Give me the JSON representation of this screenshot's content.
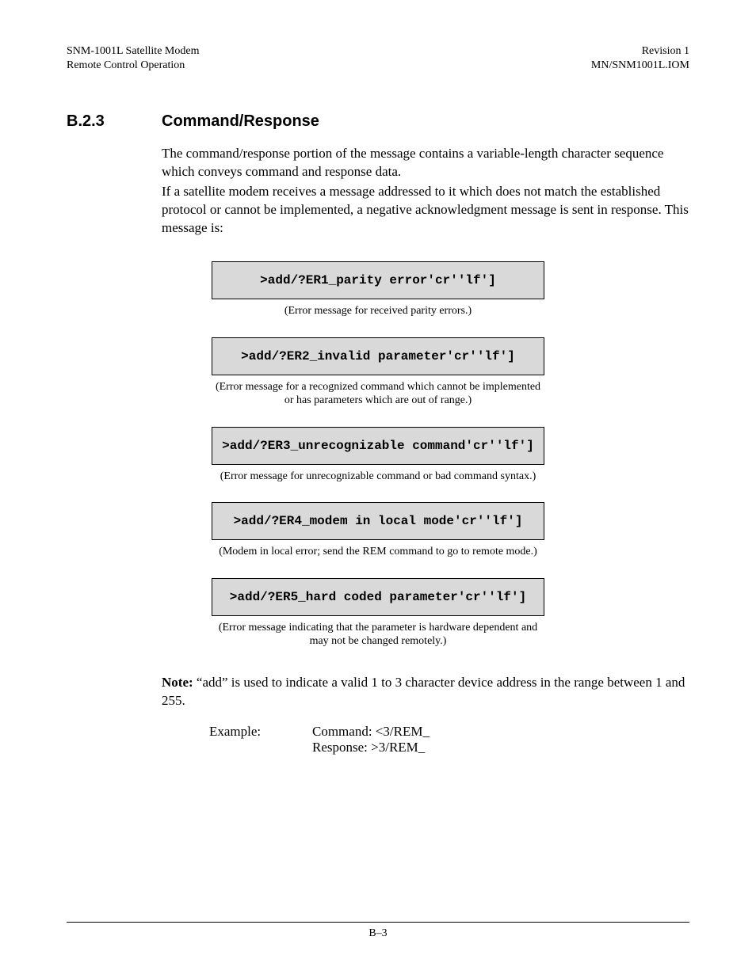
{
  "header": {
    "left1": "SNM-1001L Satellite Modem",
    "left2": "Remote Control Operation",
    "right1": "Revision 1",
    "right2": "MN/SNM1001L.IOM"
  },
  "section": {
    "number": "B.2.3",
    "title": "Command/Response"
  },
  "paragraph1": "The command/response portion of the message contains a variable-length character sequence which conveys command and response data.",
  "paragraph2": "If a satellite modem receives a message addressed to it which does not match the established protocol or cannot be implemented, a negative acknowledgment message is sent in response. This message is:",
  "errors": [
    {
      "code": ">add/?ER1_parity error'cr''lf']",
      "caption": "(Error message for received parity errors.)"
    },
    {
      "code": ">add/?ER2_invalid parameter'cr''lf']",
      "caption": "(Error message for a recognized command which cannot be implemented or has parameters which are out of range.)"
    },
    {
      "code": ">add/?ER3_unrecognizable command'cr''lf']",
      "caption": "(Error message for unrecognizable command or bad command syntax.)"
    },
    {
      "code": ">add/?ER4_modem in local mode'cr''lf']",
      "caption": "(Modem in local error; send the REM command to go to remote mode.)"
    },
    {
      "code": ">add/?ER5_hard coded parameter'cr''lf']",
      "caption": "(Error message indicating that the parameter is hardware dependent and may not be changed remotely.)"
    }
  ],
  "note": {
    "label": "Note:",
    "text": " “add” is used to indicate a valid 1 to 3 character device address in the range between 1 and 255."
  },
  "example": {
    "label": "Example:",
    "command": "Command: <3/REM_",
    "response": "Response: >3/REM_"
  },
  "footer": "B–3"
}
